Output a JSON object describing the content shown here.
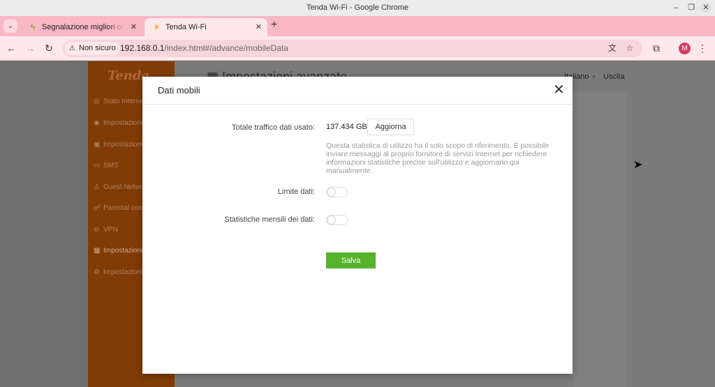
{
  "window": {
    "title": "Tenda Wi-Fi - Google Chrome"
  },
  "tabs": [
    {
      "label": "Segnalazione migliori offerte",
      "favicon": "lightning-icon"
    },
    {
      "label": "Tenda Wi-Fi",
      "favicon": "tenda-icon"
    }
  ],
  "toolbar": {
    "security_label": "Non sicuro",
    "url_host": "192.168.0.1",
    "url_path": "/index.html#/advance/mobileData",
    "profile_initial": "M"
  },
  "page": {
    "logo": "Tenda",
    "title": "Impostazioni avanzate",
    "language": "Italiano",
    "logout": "Uscita",
    "nav": [
      "Stato Internet",
      "Impostazioni Internet",
      "Impostazioni Wi-Fi",
      "SMS",
      "Guest Network",
      "Parental control",
      "VPN",
      "Impostazioni avanzate",
      "Impostazioni sistema"
    ]
  },
  "modal": {
    "title": "Dati mobili",
    "traffic_label": "Totale traffico dati usato:",
    "traffic_value": "137.434 GB",
    "refresh_label": "Aggiorna",
    "help_text": "Questa statistica di utilizzo ha il solo scopo di riferimento. È possibile inviare messaggi al proprio fornitore di servizi Internet per richiedere informazioni statistiche precise sull'utilizzo e aggiornarlo qui manualmente.",
    "data_limit_label": "Limite dati:",
    "data_limit_on": false,
    "monthly_stats_label": "Statistiche mensili dei dati:",
    "monthly_stats_on": false,
    "save_label": "Salva"
  },
  "colors": {
    "tabstrip": "#f8b8c4",
    "sidebar": "#813c05",
    "save_button": "#55b42b"
  }
}
